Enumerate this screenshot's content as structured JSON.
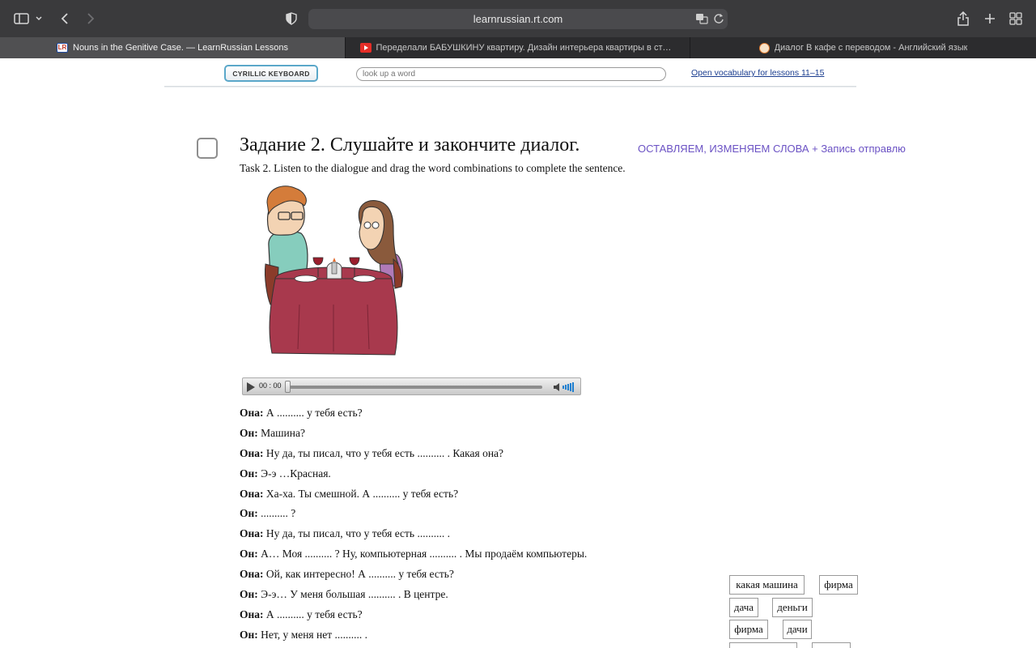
{
  "browser": {
    "url": "learnrussian.rt.com",
    "tabs": [
      {
        "title": "Nouns in the Genitive Case. — LearnRussian Lessons",
        "favicon": "learnrussian-favicon",
        "active": true
      },
      {
        "title": "Переделали БАБУШКИНУ квартиру. Дизайн интерьера квартиры в старом…",
        "favicon": "youtube-favicon",
        "active": false
      },
      {
        "title": "Диалог В кафе с переводом - Английский язык",
        "favicon": "site-favicon",
        "active": false
      }
    ]
  },
  "header": {
    "keyboard_button": "CYRILLIC KEYBOARD",
    "lookup_placeholder": "look up a word",
    "vocab_link": "Open vocabulary for lessons 11–15"
  },
  "task": {
    "title": "Задание 2. Слушайте и закончите диалог.",
    "note": "ОСТАВЛЯЕМ, ИЗМЕНЯЕМ СЛОВА + Запись отправлю",
    "subtitle": "Task 2. Listen to the dialogue and drag the word combinations to complete the sentence."
  },
  "player": {
    "time": "00 : 00"
  },
  "dialogue": [
    {
      "speaker": "Она:",
      "text": "А .......... у тебя есть?"
    },
    {
      "speaker": "Он:",
      "text": "Машина?"
    },
    {
      "speaker": "Она:",
      "text": "Ну да, ты писал, что у тебя есть .......... . Какая она?"
    },
    {
      "speaker": "Он:",
      "text": "Э-э …Красная."
    },
    {
      "speaker": "Она:",
      "text": "Ха-ха. Ты смешной. А .......... у тебя есть?"
    },
    {
      "speaker": "Он:",
      "text": ".......... ?"
    },
    {
      "speaker": "Она:",
      "text": "Ну да, ты писал, что у тебя есть .......... ."
    },
    {
      "speaker": "Он:",
      "text": "А… Моя .......... ? Ну, компьютерная .......... . Мы продаём компьютеры."
    },
    {
      "speaker": "Она:",
      "text": "Ой, как интересно! А .......... у тебя есть?"
    },
    {
      "speaker": "Он:",
      "text": "Э-э… У меня большая .......... . В центре."
    },
    {
      "speaker": "Она:",
      "text": "А .......... у тебя есть?"
    },
    {
      "speaker": "Он:",
      "text": "Нет, у меня нет .......... ."
    }
  ],
  "word_bank": [
    "какая машина",
    "фирма",
    "дача",
    "деньги",
    "фирма",
    "дачи"
  ],
  "colors": {
    "accent_link": "#1a3d8f",
    "note_purple": "#6b52c4",
    "keyboard_border": "#5aa7c9"
  }
}
